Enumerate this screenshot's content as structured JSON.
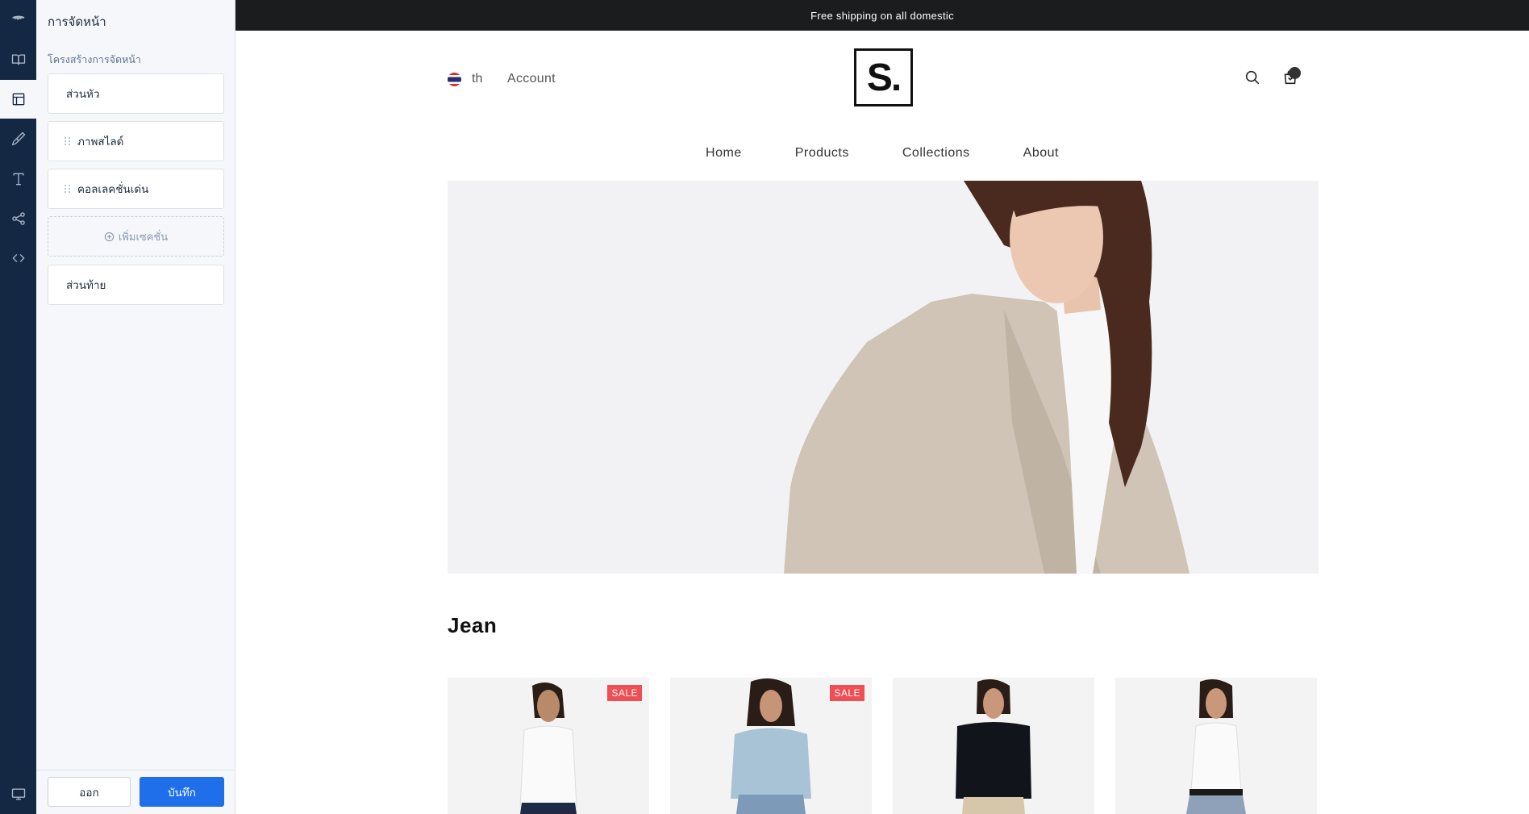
{
  "editor": {
    "panel_title": "การจัดหน้า",
    "panel_subtitle": "โครงสร้างการจัดหน้า",
    "sections": {
      "header": "ส่วนหัว",
      "slideshow": "ภาพสไลด์",
      "featured_collection": "คอลเลคชั่นเด่น",
      "add_section": "เพิ่มเซคชั่น",
      "footer": "ส่วนท้าย"
    },
    "exit_label": "ออก",
    "save_label": "บันทึก",
    "rail_icons": [
      "brand-logo-icon",
      "book-icon",
      "layout-icon",
      "paint-brush-icon",
      "text-icon",
      "share-icon",
      "code-icon",
      "desktop-icon"
    ],
    "accent_color": "#1f6feb"
  },
  "store": {
    "announcement": "Free shipping on all domestic",
    "language": "th",
    "account_label": "Account",
    "logo_text": "S.",
    "nav": [
      "Home",
      "Products",
      "Collections",
      "About"
    ],
    "section_title": "Jean",
    "products": [
      {
        "badge": "SALE"
      },
      {
        "badge": "SALE"
      },
      {
        "badge": ""
      },
      {
        "badge": ""
      }
    ],
    "sale_badge_color": "#f04e55"
  }
}
